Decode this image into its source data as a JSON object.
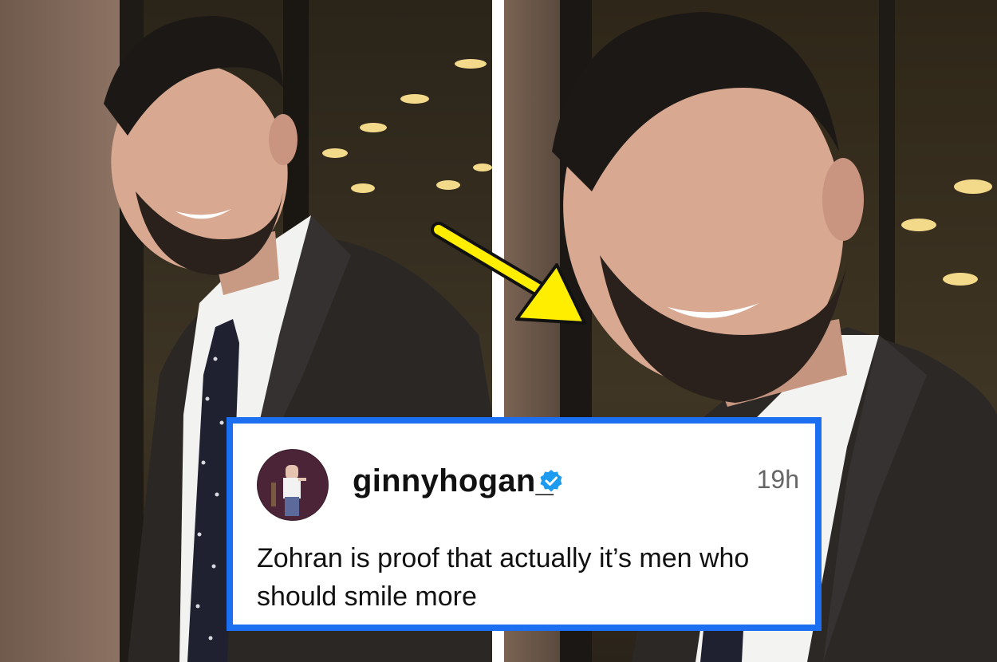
{
  "post": {
    "username": "ginnyhogan_",
    "timestamp": "19h",
    "text": "Zohran is proof that actually it’s men who should smile more",
    "verified_icon": "verified-badge-icon"
  },
  "colors": {
    "card_border": "#1d6ff2",
    "verified_badge": "#1d9bf0",
    "arrow": "#ffee00"
  }
}
